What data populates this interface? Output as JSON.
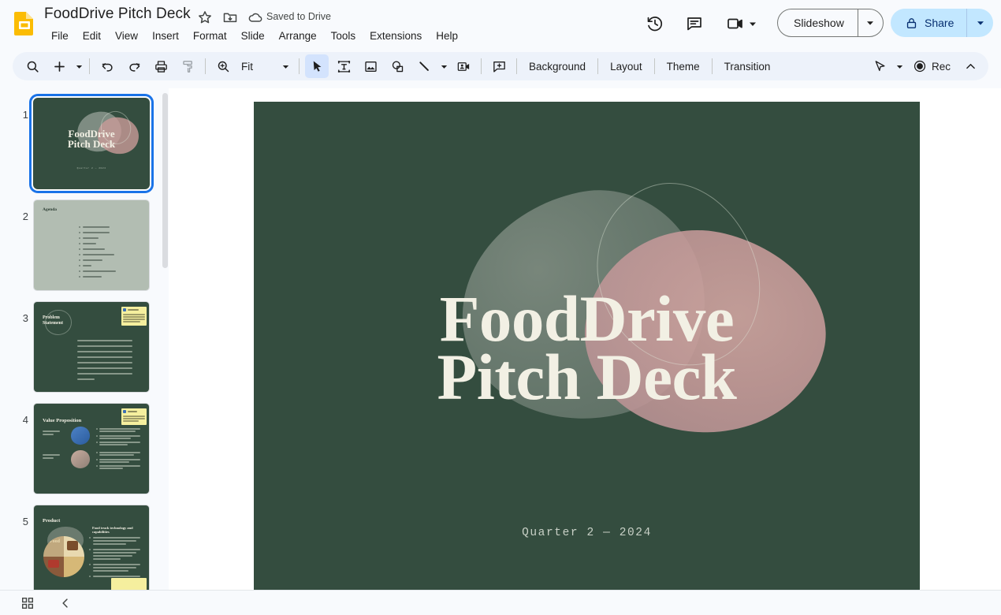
{
  "app": {
    "name": "Google Slides",
    "icon": "slides-app-icon"
  },
  "titlebar": {
    "document_title": "FoodDrive Pitch Deck",
    "star_icon": "star-icon",
    "move_icon": "move-to-folder-icon",
    "cloud_icon": "cloud-saved-icon",
    "save_status": "Saved to Drive",
    "history_icon": "version-history-icon",
    "comment_icon": "comment-icon",
    "meet_icon": "meet-video-icon",
    "meet_caret_icon": "chevron-down-icon",
    "slideshow_label": "Slideshow",
    "slideshow_caret_icon": "chevron-down-icon",
    "share_label": "Share",
    "share_lock_icon": "lock-icon",
    "share_caret_icon": "chevron-down-icon"
  },
  "menubar": {
    "items": [
      {
        "label": "File"
      },
      {
        "label": "Edit"
      },
      {
        "label": "View"
      },
      {
        "label": "Insert"
      },
      {
        "label": "Format"
      },
      {
        "label": "Slide"
      },
      {
        "label": "Arrange"
      },
      {
        "label": "Tools"
      },
      {
        "label": "Extensions"
      },
      {
        "label": "Help"
      }
    ]
  },
  "toolbar": {
    "search_icon": "search-icon",
    "new_slide_icon": "plus-icon",
    "new_slide_caret_icon": "chevron-down-icon",
    "undo_icon": "undo-icon",
    "redo_icon": "redo-icon",
    "print_icon": "print-icon",
    "paint_format_icon": "paint-format-icon",
    "zoom_icon": "zoom-icon",
    "zoom_level": "Fit",
    "zoom_caret_icon": "chevron-down-icon",
    "select_icon": "cursor-select-icon",
    "textbox_icon": "text-box-icon",
    "image_icon": "insert-image-icon",
    "shape_icon": "insert-shape-icon",
    "line_icon": "insert-line-icon",
    "line_caret_icon": "chevron-down-icon",
    "video_icon": "insert-video-icon",
    "comment_icon": "add-comment-icon",
    "background_label": "Background",
    "layout_label": "Layout",
    "theme_label": "Theme",
    "transition_label": "Transition",
    "laser_icon": "laser-pointer-icon",
    "laser_caret_icon": "chevron-down-icon",
    "rec_icon": "record-icon",
    "rec_label": "Rec",
    "collapse_icon": "chevron-up-icon"
  },
  "filmstrip": {
    "scrollbar": "filmstrip-scrollbar",
    "slides": [
      {
        "number": "1",
        "selected": true,
        "kind": "title",
        "title": "FoodDrive\nPitch Deck",
        "subtitle": "Quarter 2 — 2024"
      },
      {
        "number": "2",
        "selected": false,
        "kind": "agenda",
        "title": "Agenda",
        "bullets": [
          "Problem Statement",
          "Value Proposition",
          "Product",
          "Why Now",
          "Business Model",
          "Competition Landscape",
          "Go-To-Market",
          "Team",
          "Timeline and Milestones",
          "Fundraising"
        ]
      },
      {
        "number": "3",
        "selected": false,
        "kind": "text",
        "title": "Problem\nStatement",
        "has_note": true,
        "body_lines": 8
      },
      {
        "number": "4",
        "selected": false,
        "kind": "value",
        "title": "Value Proposition",
        "has_note": true,
        "items": [
          {
            "label": "Convenience and Efficiency",
            "blob": "#3d6fb5",
            "bullets": 3
          },
          {
            "label": "Innovation Focused Deliveries",
            "blob": "#c2a193",
            "bullets": 3
          }
        ]
      },
      {
        "number": "5",
        "selected": false,
        "kind": "product",
        "title": "Product",
        "subtitle": "Food truck technology and capabilities",
        "bullets": 4
      }
    ]
  },
  "main_slide": {
    "background_color": "#344d3f",
    "title": "FoodDrive\nPitch Deck",
    "subtitle": "Quarter 2 — 2024",
    "title_color": "#f2f0e4",
    "shapes": [
      {
        "name": "grey-green-blob",
        "color": "#6d7d72"
      },
      {
        "name": "pink-blob",
        "color": "#cb9d9c"
      },
      {
        "name": "outline-ellipse",
        "color": "#e2e9dc"
      }
    ]
  },
  "bottombar": {
    "grid_view_icon": "grid-view-icon",
    "collapse_filmstrip_icon": "chevron-left-icon"
  }
}
